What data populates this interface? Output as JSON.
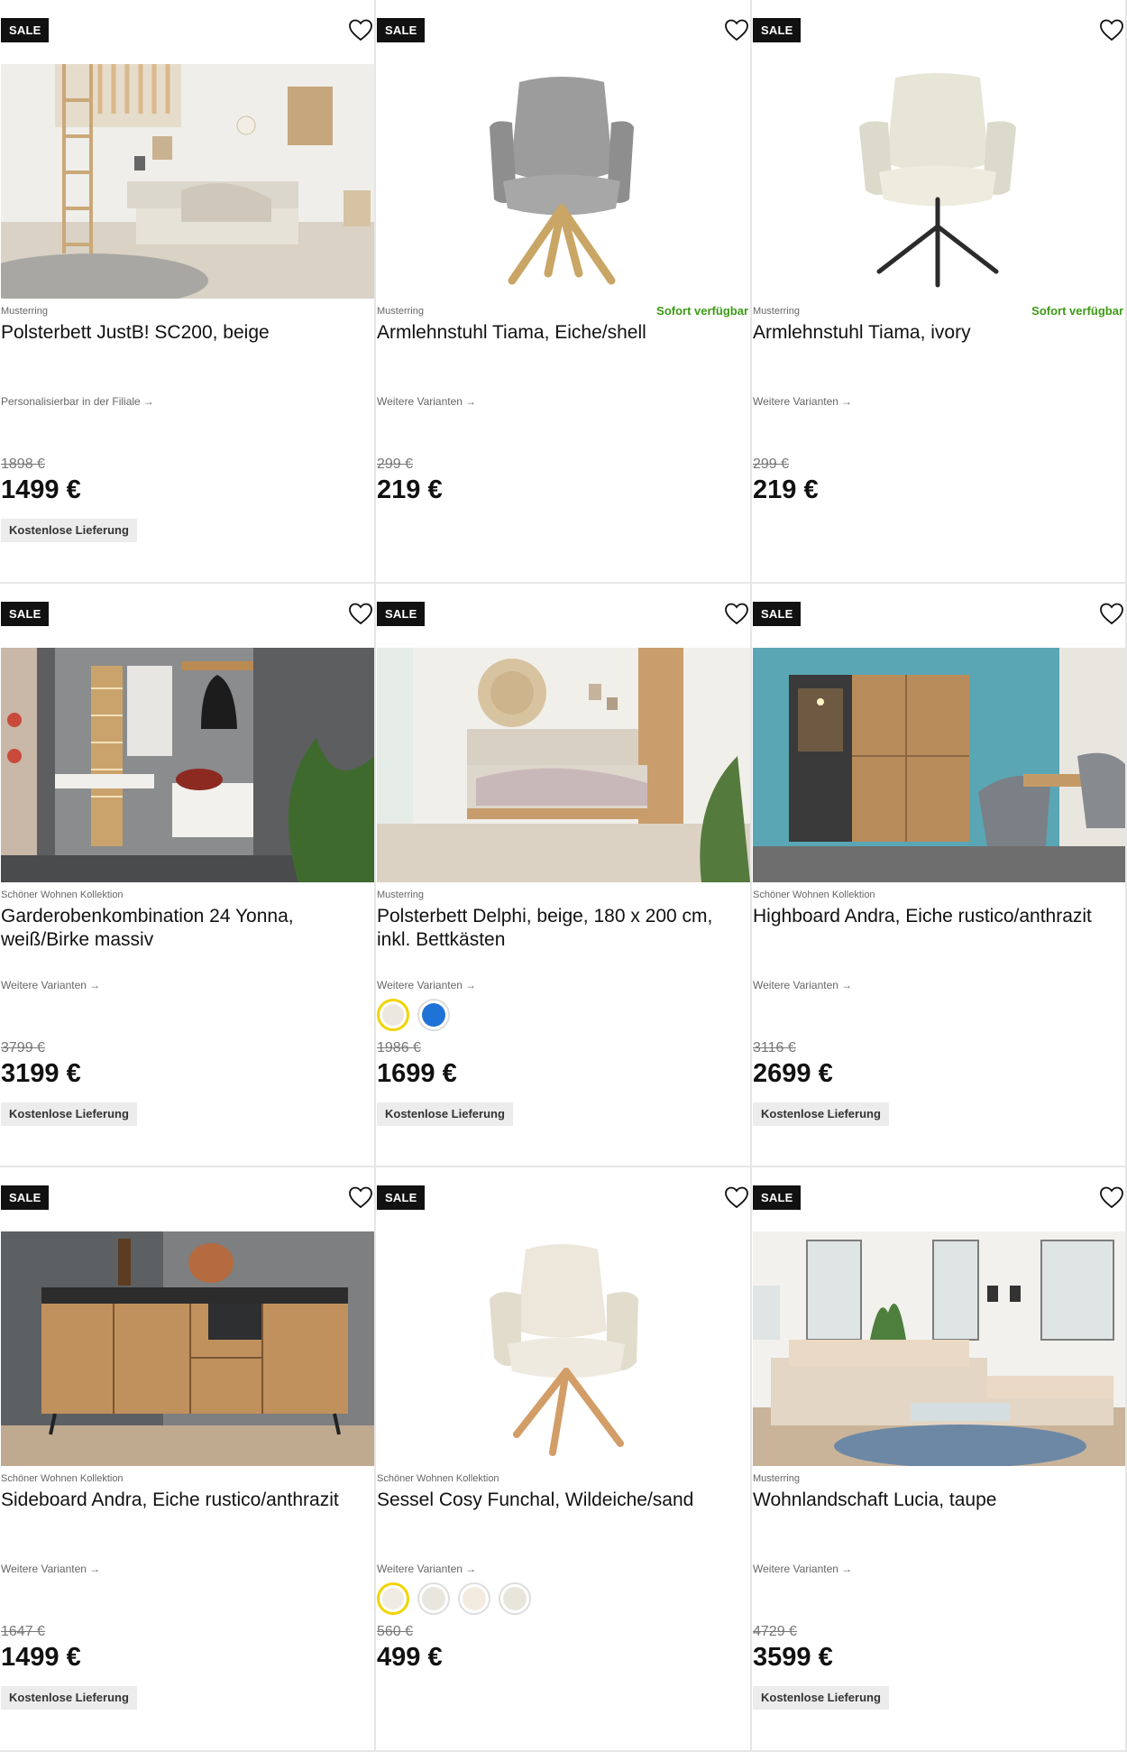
{
  "colors": {
    "badge": "#111111",
    "availability": "#3c9a15",
    "swatch_selected_ring": "#f2d400"
  },
  "products": [
    {
      "badge": "SALE",
      "brand": "Musterring",
      "title": "Polsterbett JustB! SC200, beige",
      "availability": "",
      "variants_link": "Personalisierbar in der Filiale",
      "old_price": "1898 €",
      "price": "1499 €",
      "delivery": "Kostenlose Lieferung",
      "image": "bedroom-loft-bed-image",
      "swatches": []
    },
    {
      "badge": "SALE",
      "brand": "Musterring",
      "title": "Armlehnstuhl Tiama, Eiche/shell",
      "availability": "Sofort verfügbar",
      "variants_link": "Weitere Varianten",
      "old_price": "299 €",
      "price": "219 €",
      "delivery": "",
      "image": "grey-armchair-oak-legs-image",
      "swatches": []
    },
    {
      "badge": "SALE",
      "brand": "Musterring",
      "title": "Armlehnstuhl Tiama, ivory",
      "availability": "Sofort verfügbar",
      "variants_link": "Weitere Varianten",
      "old_price": "299 €",
      "price": "219 €",
      "delivery": "",
      "image": "ivory-armchair-black-legs-image",
      "swatches": []
    },
    {
      "badge": "SALE",
      "brand": "Schöner Wohnen Kollektion",
      "title": "Garderobenkombination 24 Yonna, weiß/Birke massiv",
      "availability": "",
      "variants_link": "Weitere Varianten",
      "old_price": "3799 €",
      "price": "3199 €",
      "delivery": "Kostenlose Lieferung",
      "image": "hallway-wardrobe-image",
      "swatches": []
    },
    {
      "badge": "SALE",
      "brand": "Musterring",
      "title": "Polsterbett Delphi, beige, 180 x 200 cm, inkl. Bettkästen",
      "availability": "",
      "variants_link": "Weitere Varianten",
      "old_price": "1986 €",
      "price": "1699 €",
      "delivery": "Kostenlose Lieferung",
      "image": "bedroom-delphi-bed-image",
      "swatches": [
        {
          "color": "#ece8df",
          "selected": true
        },
        {
          "color": "#1f72d6",
          "selected": false
        }
      ]
    },
    {
      "badge": "SALE",
      "brand": "Schöner Wohnen Kollektion",
      "title": "Highboard Andra, Eiche rustico/anthrazit",
      "availability": "",
      "variants_link": "Weitere Varianten",
      "old_price": "3116 €",
      "price": "2699 €",
      "delivery": "Kostenlose Lieferung",
      "image": "highboard-dining-room-image",
      "swatches": []
    },
    {
      "badge": "SALE",
      "brand": "Schöner Wohnen Kollektion",
      "title": "Sideboard Andra, Eiche rustico/anthrazit",
      "availability": "",
      "variants_link": "Weitere Varianten",
      "old_price": "1647 €",
      "price": "1499 €",
      "delivery": "Kostenlose Lieferung",
      "image": "sideboard-image",
      "swatches": []
    },
    {
      "badge": "SALE",
      "brand": "Schöner Wohnen Kollektion",
      "title": "Sessel Cosy Funchal, Wildeiche/sand",
      "availability": "",
      "variants_link": "Weitere Varianten",
      "old_price": "560 €",
      "price": "499 €",
      "delivery": "",
      "image": "cream-armchair-wooden-legs-image",
      "swatches": [
        {
          "color": "#efece3",
          "selected": true
        },
        {
          "color": "#e9e6de",
          "selected": false
        },
        {
          "color": "#f3ebe0",
          "selected": false
        },
        {
          "color": "#e8e6da",
          "selected": false
        }
      ]
    },
    {
      "badge": "SALE",
      "brand": "Musterring",
      "title": "Wohnlandschaft Lucia, taupe",
      "availability": "",
      "variants_link": "Weitere Varianten",
      "old_price": "4729 €",
      "price": "3599 €",
      "delivery": "Kostenlose Lieferung",
      "image": "living-room-sofa-image",
      "swatches": []
    }
  ]
}
